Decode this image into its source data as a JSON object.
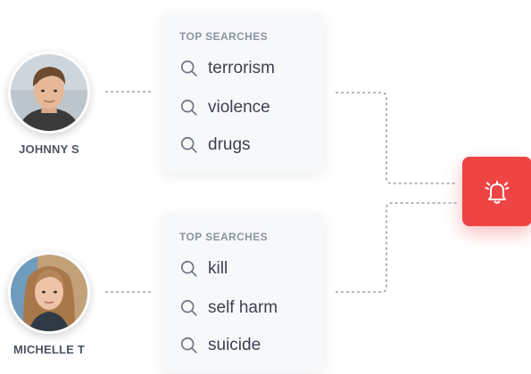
{
  "users": [
    {
      "name": "JOHNNY S",
      "avatar": "male-user-photo",
      "panel_title": "TOP SEARCHES",
      "searches": [
        "terrorism",
        "violence",
        "drugs"
      ]
    },
    {
      "name": "MICHELLE T",
      "avatar": "female-user-photo",
      "panel_title": "TOP SEARCHES",
      "searches": [
        "kill",
        "self harm",
        "suicide"
      ]
    }
  ],
  "alert": {
    "icon": "bell-alert-icon",
    "color": "#ef4444"
  },
  "colors": {
    "connector": "#9aa3ad",
    "card_bg": "#f7f8fa",
    "text": "#3b4250",
    "muted": "#8a94a3"
  }
}
